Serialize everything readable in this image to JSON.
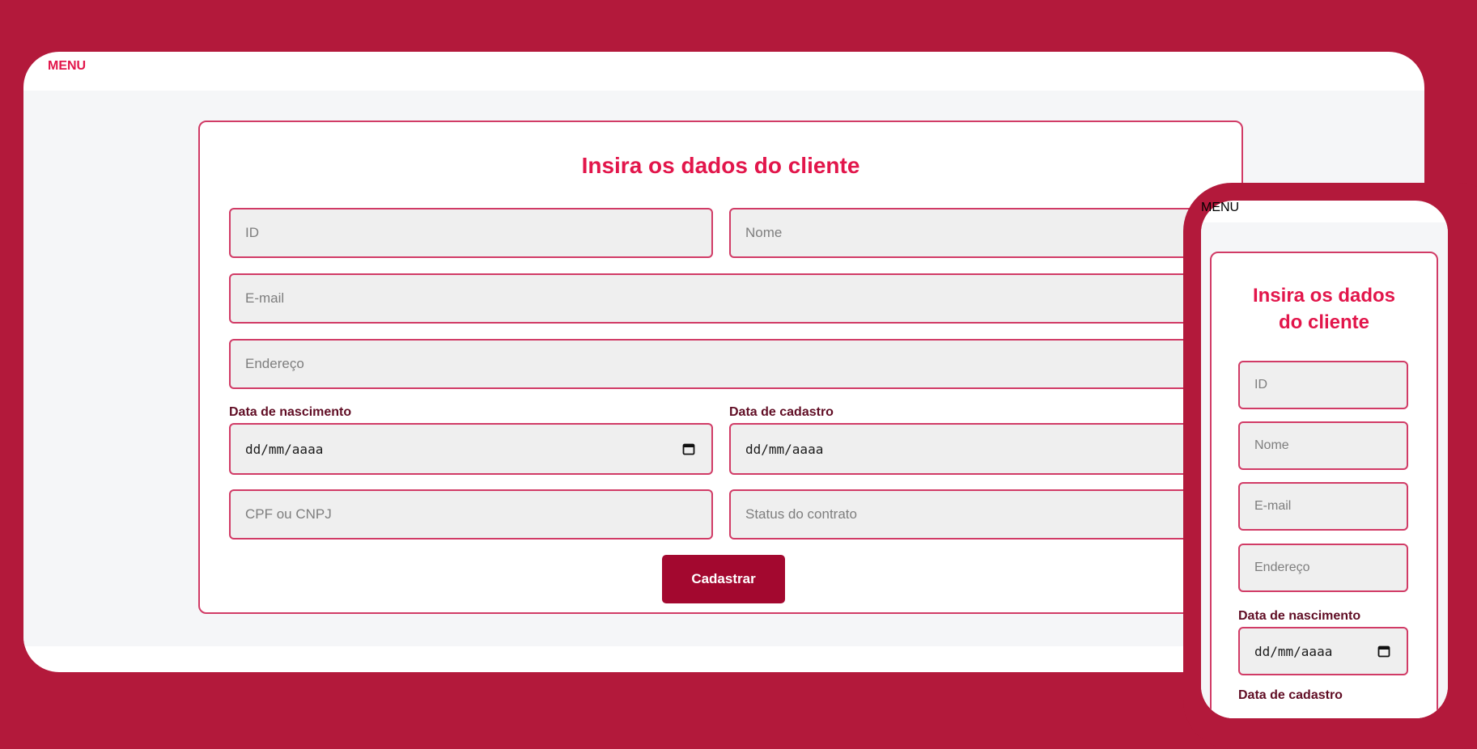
{
  "app": {
    "menu_label": "MENU"
  },
  "form": {
    "title": "Insira os dados do cliente",
    "placeholders": {
      "id": "ID",
      "nome": "Nome",
      "email": "E-mail",
      "endereco": "Endereço",
      "cpf": "CPF ou CNPJ",
      "status": "Status do contrato"
    },
    "labels": {
      "nascimento": "Data de nascimento",
      "cadastro": "Data de cadastro"
    },
    "date_value": "dd/mm/aaaa",
    "submit_label": "Cadastrar"
  },
  "mobile": {
    "menu_label": "MENU",
    "title_line1": "Insira os dados",
    "title_line2": "do cliente"
  },
  "colors": {
    "background": "#b3193b",
    "accent": "#e2164b",
    "border": "#d13b66",
    "button": "#a3082f"
  },
  "icons": {
    "date_picker": "calendar-icon"
  }
}
